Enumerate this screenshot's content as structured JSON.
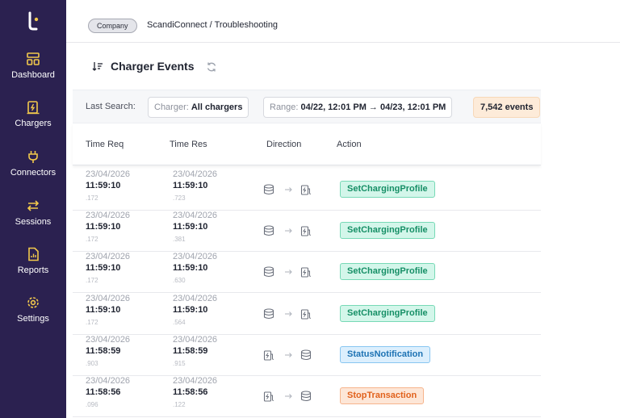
{
  "colors": {
    "sidebar_bg": "#2b2150",
    "accent": "#f2c94c",
    "action_green": "#168f66",
    "action_blue": "#1c72b3",
    "action_orange": "#e1611c",
    "events_chip_bg": "#fdebd9"
  },
  "sidebar": {
    "logo_icon": "brand-logo-icon",
    "items": [
      {
        "label": "Dashboard",
        "icon": "dashboard-icon"
      },
      {
        "label": "Chargers",
        "icon": "charger-icon"
      },
      {
        "label": "Connectors",
        "icon": "plug-icon"
      },
      {
        "label": "Sessions",
        "icon": "swap-arrows-icon"
      },
      {
        "label": "Reports",
        "icon": "report-icon"
      },
      {
        "label": "Settings",
        "icon": "gear-icon"
      }
    ]
  },
  "header": {
    "badge": "Company",
    "breadcrumb": "ScandiConnect / Troubleshooting"
  },
  "panel": {
    "title": "Charger Events",
    "filters": {
      "last_search_label": "Last Search:",
      "charger_label": "Charger:",
      "charger_value": "All chargers",
      "range_label": "Range:",
      "range_value": "04/22, 12:01 PM → 04/23, 12:01 PM",
      "events_count": "7,542 events"
    },
    "columns": {
      "time_req": "Time Req",
      "time_res": "Time Res",
      "direction": "Direction",
      "action": "Action"
    },
    "rows": [
      {
        "req_date": "23/04/2026",
        "req_time": "11:59:10",
        "req_ms": ".172",
        "res_date": "23/04/2026",
        "res_time": "11:59:10",
        "res_ms": ".723",
        "direction": "server-to-charger",
        "action": "SetChargingProfile"
      },
      {
        "req_date": "23/04/2026",
        "req_time": "11:59:10",
        "req_ms": ".172",
        "res_date": "23/04/2026",
        "res_time": "11:59:10",
        "res_ms": ".381",
        "direction": "server-to-charger",
        "action": "SetChargingProfile"
      },
      {
        "req_date": "23/04/2026",
        "req_time": "11:59:10",
        "req_ms": ".172",
        "res_date": "23/04/2026",
        "res_time": "11:59:10",
        "res_ms": ".630",
        "direction": "server-to-charger",
        "action": "SetChargingProfile"
      },
      {
        "req_date": "23/04/2026",
        "req_time": "11:59:10",
        "req_ms": ".172",
        "res_date": "23/04/2026",
        "res_time": "11:59:10",
        "res_ms": ".564",
        "direction": "server-to-charger",
        "action": "SetChargingProfile"
      },
      {
        "req_date": "23/04/2026",
        "req_time": "11:58:59",
        "req_ms": ".903",
        "res_date": "23/04/2026",
        "res_time": "11:58:59",
        "res_ms": ".915",
        "direction": "charger-to-server",
        "action": "StatusNotification"
      },
      {
        "req_date": "23/04/2026",
        "req_time": "11:58:56",
        "req_ms": ".096",
        "res_date": "23/04/2026",
        "res_time": "11:58:56",
        "res_ms": ".122",
        "direction": "charger-to-server",
        "action": "StopTransaction"
      }
    ]
  }
}
